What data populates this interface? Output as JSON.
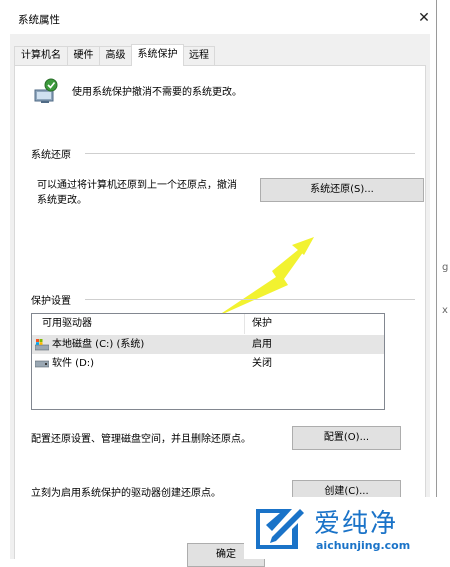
{
  "window": {
    "title": "系统属性"
  },
  "tabs": [
    {
      "label": "计算机名"
    },
    {
      "label": "硬件"
    },
    {
      "label": "高级"
    },
    {
      "label": "系统保护"
    },
    {
      "label": "远程"
    }
  ],
  "intro": {
    "text": "使用系统保护撤消不需要的系统更改。"
  },
  "restore": {
    "group_title": "系统还原",
    "description_line1": "可以通过将计算机还原到上一个还原点，撤消",
    "description_line2": "系统更改。",
    "button_label": "系统还原(S)..."
  },
  "protection": {
    "group_title": "保护设置",
    "columns": [
      "可用驱动器",
      "保护"
    ],
    "rows": [
      {
        "drive": "本地磁盘 (C:) (系统)",
        "status": "启用"
      },
      {
        "drive": "软件 (D:)",
        "status": "关闭"
      }
    ],
    "configure_text": "配置还原设置、管理磁盘空间，并且删除还原点。",
    "configure_button": "配置(O)...",
    "create_text": "立刻为启用系统保护的驱动器创建还原点。",
    "create_button": "创建(C)..."
  },
  "footer": {
    "ok_button": "确定"
  },
  "watermark": {
    "brand": "爱纯净",
    "url": "aichunjing.com"
  },
  "background": {
    "glyph_g": "g",
    "glyph_x": "x"
  },
  "colors": {
    "arrow": "#f2f230",
    "logo_blue": "#1a73c8",
    "selected_row": "#e5e5e5",
    "button_face": "#e1e1e1"
  }
}
